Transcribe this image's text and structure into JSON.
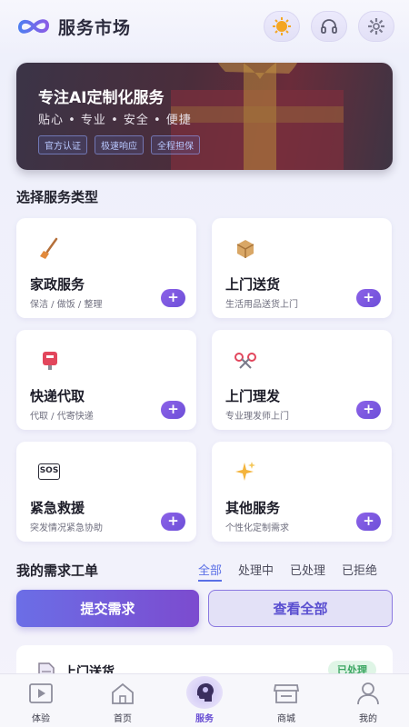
{
  "header": {
    "title": "服务市场",
    "logo_icon": "infinity-logo-icon",
    "actions": [
      {
        "name": "sun-icon"
      },
      {
        "name": "headset-icon"
      },
      {
        "name": "gear-icon"
      }
    ]
  },
  "hero": {
    "title": "专注AI定制化服务",
    "subtitle": "贴心 • 专业 • 安全 • 便捷",
    "tags": [
      "官方认证",
      "极速响应",
      "全程担保"
    ]
  },
  "services": {
    "section_title": "选择服务类型",
    "add_symbol": "+",
    "items": [
      {
        "name": "家政服务",
        "desc": "保洁 / 做饭 / 整理",
        "icon": "broom-icon"
      },
      {
        "name": "上门送货",
        "desc": "生活用品送货上门",
        "icon": "package-icon"
      },
      {
        "name": "快递代取",
        "desc": "代取 / 代寄快递",
        "icon": "postbox-icon"
      },
      {
        "name": "上门理发",
        "desc": "专业理发师上门",
        "icon": "scissors-icon"
      },
      {
        "name": "紧急救援",
        "desc": "突发情况紧急协助",
        "icon": "sos-icon",
        "icon_text": "SOS"
      },
      {
        "name": "其他服务",
        "desc": "个性化定制需求",
        "icon": "sparkles-icon"
      }
    ]
  },
  "orders": {
    "title": "我的需求工单",
    "tabs": [
      "全部",
      "处理中",
      "已处理",
      "已拒绝"
    ],
    "active_tab": 0,
    "submit_label": "提交需求",
    "view_all_label": "查看全部",
    "first_order": {
      "name": "上门送货",
      "status": "已处理",
      "icon": "document-icon"
    }
  },
  "nav": {
    "items": [
      {
        "label": "体验",
        "icon": "play-icon"
      },
      {
        "label": "首页",
        "icon": "home-icon"
      },
      {
        "label": "服务",
        "icon": "brain-head-icon"
      },
      {
        "label": "商城",
        "icon": "store-icon"
      },
      {
        "label": "我的",
        "icon": "user-icon"
      }
    ],
    "active": 2
  },
  "colors": {
    "accent": "#6d4fd8",
    "submit_gradient_start": "#6b6ee6",
    "submit_gradient_end": "#7c4bcf",
    "status_done": "#3aa561"
  }
}
